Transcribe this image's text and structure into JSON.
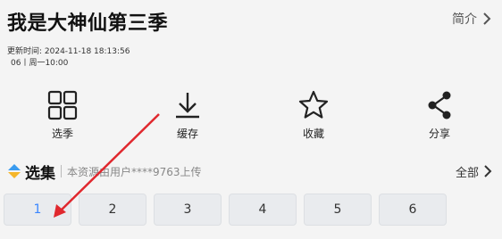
{
  "header": {
    "title": "我是大神仙第三季",
    "intro_label": "简介"
  },
  "meta": {
    "updated": "更新时间:  2024-11-18 18:13:56",
    "schedule": "06丨周一10:00"
  },
  "actions": [
    {
      "label": "选季",
      "icon": "grid-icon"
    },
    {
      "label": "缓存",
      "icon": "download-icon"
    },
    {
      "label": "收藏",
      "icon": "star-icon"
    },
    {
      "label": "分享",
      "icon": "share-icon"
    }
  ],
  "section": {
    "heading": "选集",
    "source": "本资源由用户****9763上传",
    "all_label": "全部"
  },
  "episodes": [
    "1",
    "2",
    "3",
    "4",
    "5",
    "6"
  ],
  "colors": {
    "accent": "#3a86ff",
    "annotation_arrow": "#e0282e"
  }
}
